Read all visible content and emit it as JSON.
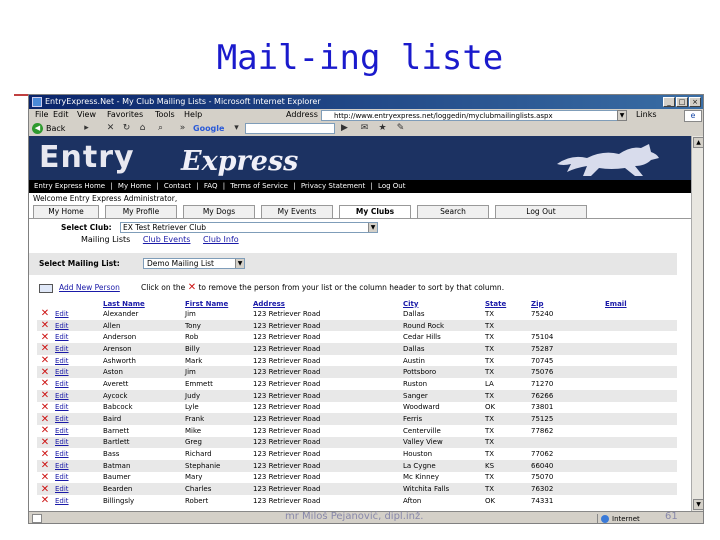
{
  "slide": {
    "title": "Mail-ing liste",
    "footer": "mr Miloš Pejanović, dipl.inž.",
    "page_number": "61"
  },
  "browser": {
    "window_title": "EntryExpress.Net - My Club Mailing Lists - Microsoft Internet Explorer",
    "menu": [
      "File",
      "Edit",
      "View",
      "Favorites",
      "Tools",
      "Help"
    ],
    "address_label": "Address",
    "address_url": "http://www.entryexpress.net/loggedin/myclubmailinglists.aspx",
    "links_label": "Links",
    "back_label": "Back",
    "google_label": "Google",
    "status_zone": "Internet"
  },
  "site": {
    "logo_entry": "Entry",
    "logo_express": "Express",
    "nav_links": [
      "Entry Express Home",
      "|",
      "My Home",
      "|",
      "Contact",
      "|",
      "FAQ",
      "|",
      "Terms of Service",
      "|",
      "Privacy Statement",
      "|",
      "Log Out"
    ],
    "welcome": "Welcome Entry Express Administrator,",
    "tabs": [
      {
        "label": "My Home",
        "active": false
      },
      {
        "label": "My Profile",
        "active": false
      },
      {
        "label": "My Dogs",
        "active": false
      },
      {
        "label": "My Events",
        "active": false
      },
      {
        "label": "My Clubs",
        "active": true
      },
      {
        "label": "Search",
        "active": false
      },
      {
        "label": "Log Out",
        "active": false
      }
    ]
  },
  "club": {
    "select_label": "Select Club:",
    "selected_club": "EX Test Retriever Club",
    "current_section": "Mailing Lists",
    "links": [
      "Club Events",
      "Club Info"
    ]
  },
  "mailing": {
    "select_label": "Select Mailing List:",
    "selected_list": "Demo Mailing List",
    "add_link": "Add New Person",
    "instruction_before": "Click on the",
    "instruction_after": "to remove the person from your list or the column header to sort by that column."
  },
  "table": {
    "edit_label": "Edit",
    "headers": [
      "Last Name",
      "First Name",
      "Address",
      "City",
      "State",
      "Zip",
      "Email"
    ],
    "rows": [
      [
        "Alexander",
        "Jim",
        "123 Retriever Road",
        "Dallas",
        "TX",
        "75240",
        ""
      ],
      [
        "Allen",
        "Tony",
        "123 Retriever Road",
        "Round Rock",
        "TX",
        "",
        ""
      ],
      [
        "Anderson",
        "Rob",
        "123 Retriever Road",
        "Cedar Hills",
        "TX",
        "75104",
        ""
      ],
      [
        "Arenson",
        "Billy",
        "123 Retriever Road",
        "Dallas",
        "TX",
        "75287",
        ""
      ],
      [
        "Ashworth",
        "Mark",
        "123 Retriever Road",
        "Austin",
        "TX",
        "70745",
        ""
      ],
      [
        "Aston",
        "Jim",
        "123 Retriever Road",
        "Pottsboro",
        "TX",
        "75076",
        ""
      ],
      [
        "Averett",
        "Emmett",
        "123 Retriever Road",
        "Ruston",
        "LA",
        "71270",
        ""
      ],
      [
        "Aycock",
        "Judy",
        "123 Retriever Road",
        "Sanger",
        "TX",
        "76266",
        ""
      ],
      [
        "Babcock",
        "Lyle",
        "123 Retriever Road",
        "Woodward",
        "OK",
        "73801",
        ""
      ],
      [
        "Baird",
        "Frank",
        "123 Retriever Road",
        "Ferris",
        "TX",
        "75125",
        ""
      ],
      [
        "Barnett",
        "Mike",
        "123 Retriever Road",
        "Centerville",
        "TX",
        "77862",
        ""
      ],
      [
        "Bartlett",
        "Greg",
        "123 Retriever Road",
        "Valley View",
        "TX",
        "",
        ""
      ],
      [
        "Bass",
        "Richard",
        "123 Retriever Road",
        "Houston",
        "TX",
        "77062",
        ""
      ],
      [
        "Batman",
        "Stephanie",
        "123 Retriever Road",
        "La Cygne",
        "KS",
        "66040",
        ""
      ],
      [
        "Baumer",
        "Mary",
        "123 Retriever Road",
        "Mc Kinney",
        "TX",
        "75070",
        ""
      ],
      [
        "Bearden",
        "Charles",
        "123 Retriever Road",
        "Witchita Falls",
        "TX",
        "76302",
        ""
      ],
      [
        "Billingsly",
        "Robert",
        "123 Retriever Road",
        "Afton",
        "OK",
        "74331",
        ""
      ]
    ]
  }
}
